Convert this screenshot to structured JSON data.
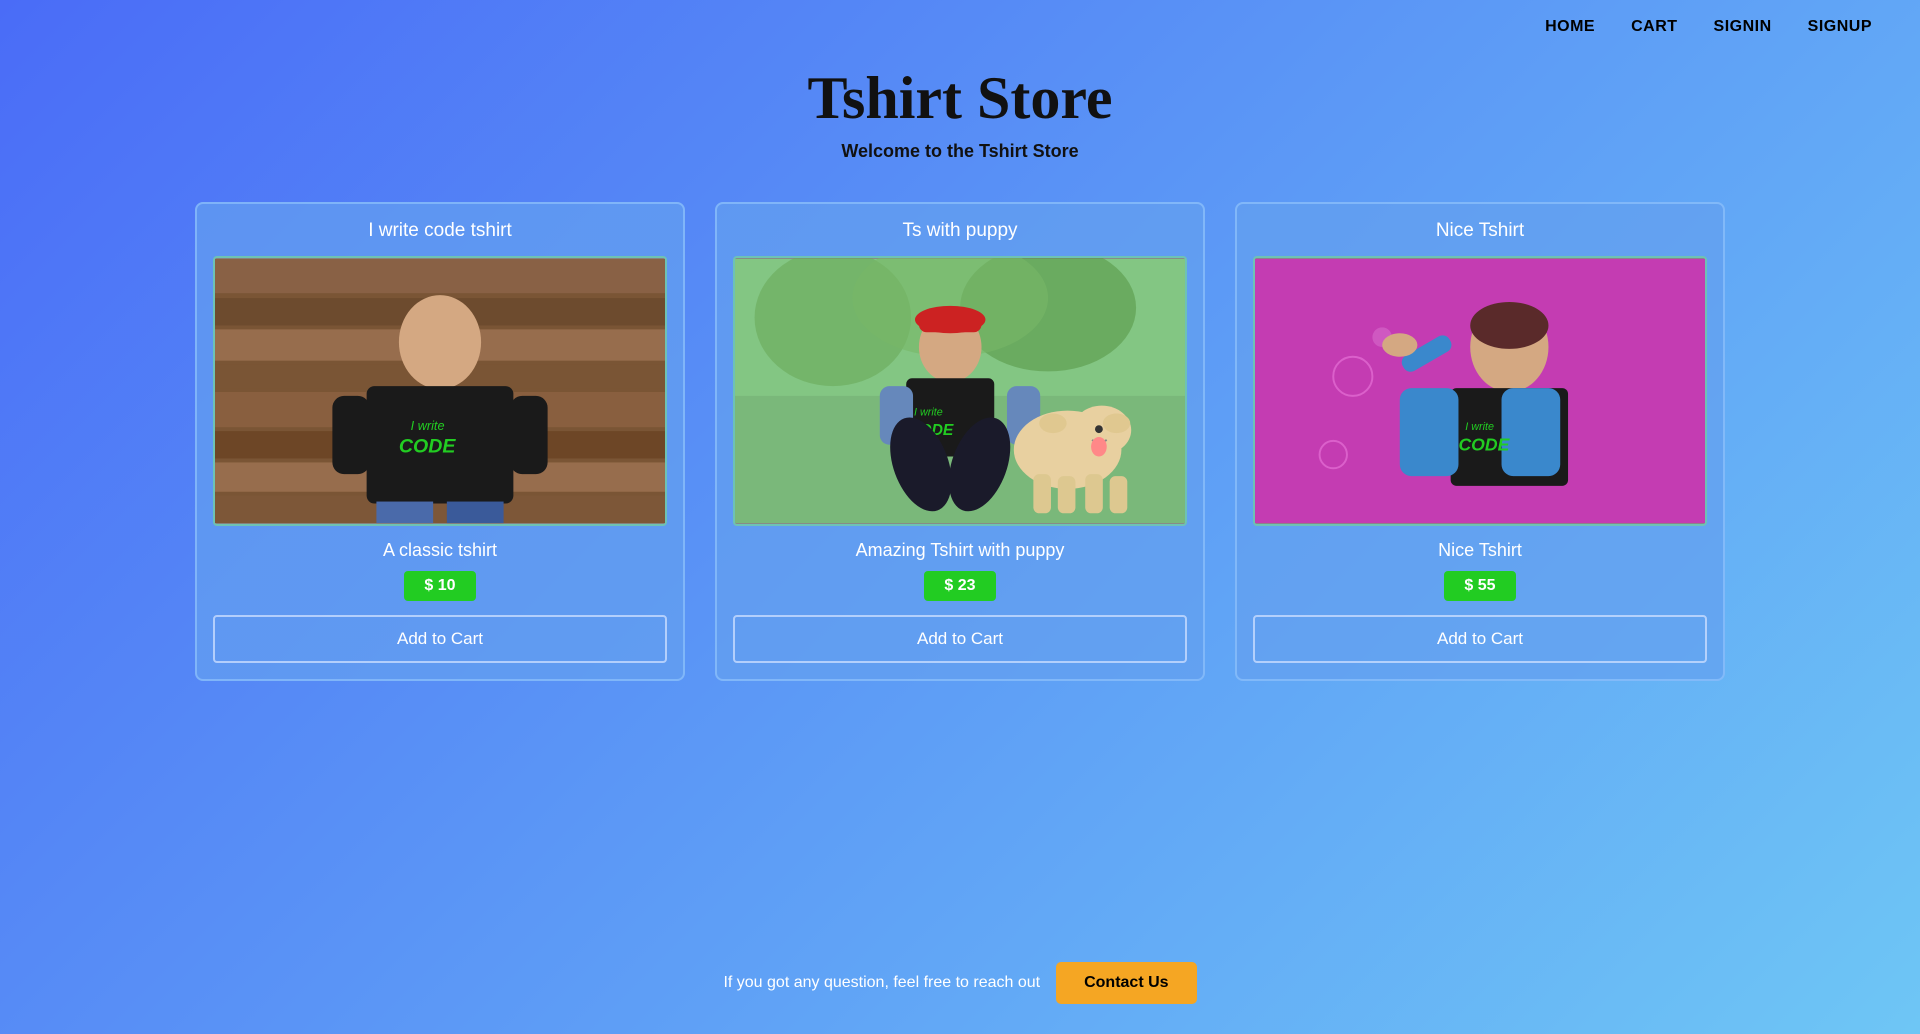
{
  "nav": {
    "items": [
      {
        "label": "HOME",
        "href": "#"
      },
      {
        "label": "CART",
        "href": "#"
      },
      {
        "label": "SIGNIN",
        "href": "#"
      },
      {
        "label": "SIGNUP",
        "href": "#"
      }
    ]
  },
  "header": {
    "title": "Tshirt Store",
    "subtitle": "Welcome to the Tshirt Store"
  },
  "products": [
    {
      "card_title": "I write code tshirt",
      "description": "A classic tshirt",
      "price": "$ 10",
      "add_to_cart_label": "Add to Cart",
      "image_type": "code"
    },
    {
      "card_title": "Ts with puppy",
      "description": "Amazing Tshirt with puppy",
      "price": "$ 23",
      "add_to_cart_label": "Add to Cart",
      "image_type": "puppy"
    },
    {
      "card_title": "Nice Tshirt",
      "description": "Nice Tshirt",
      "price": "$ 55",
      "add_to_cart_label": "Add to Cart",
      "image_type": "nice"
    }
  ],
  "footer": {
    "text": "If you got any question, feel free to reach out",
    "contact_label": "Contact Us"
  }
}
